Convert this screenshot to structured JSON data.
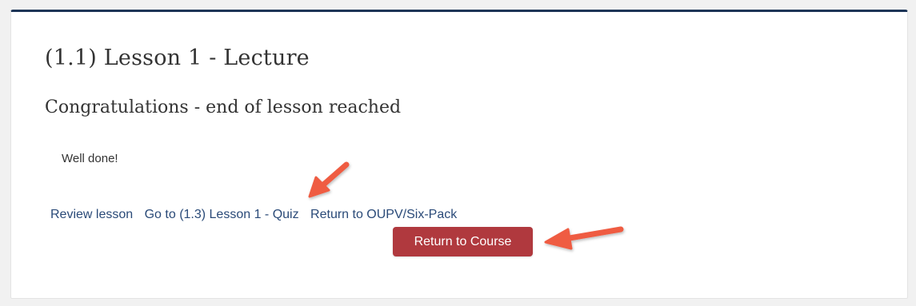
{
  "lesson": {
    "title": "(1.1) Lesson 1 - Lecture",
    "subtitle": "Congratulations - end of lesson reached",
    "message": "Well done!"
  },
  "links": {
    "review": "Review lesson",
    "next_quiz": "Go to (1.3) Lesson 1 - Quiz",
    "return_oupv": "Return to OUPV/Six-Pack"
  },
  "button": {
    "return_course": "Return to Course"
  },
  "colors": {
    "header_accent": "#1d3557",
    "link": "#2a4a78",
    "button": "#b0393e",
    "annotation_arrow": "#ef5b43"
  },
  "annotations": {
    "arrow_icon": "red-arrow-icon"
  }
}
